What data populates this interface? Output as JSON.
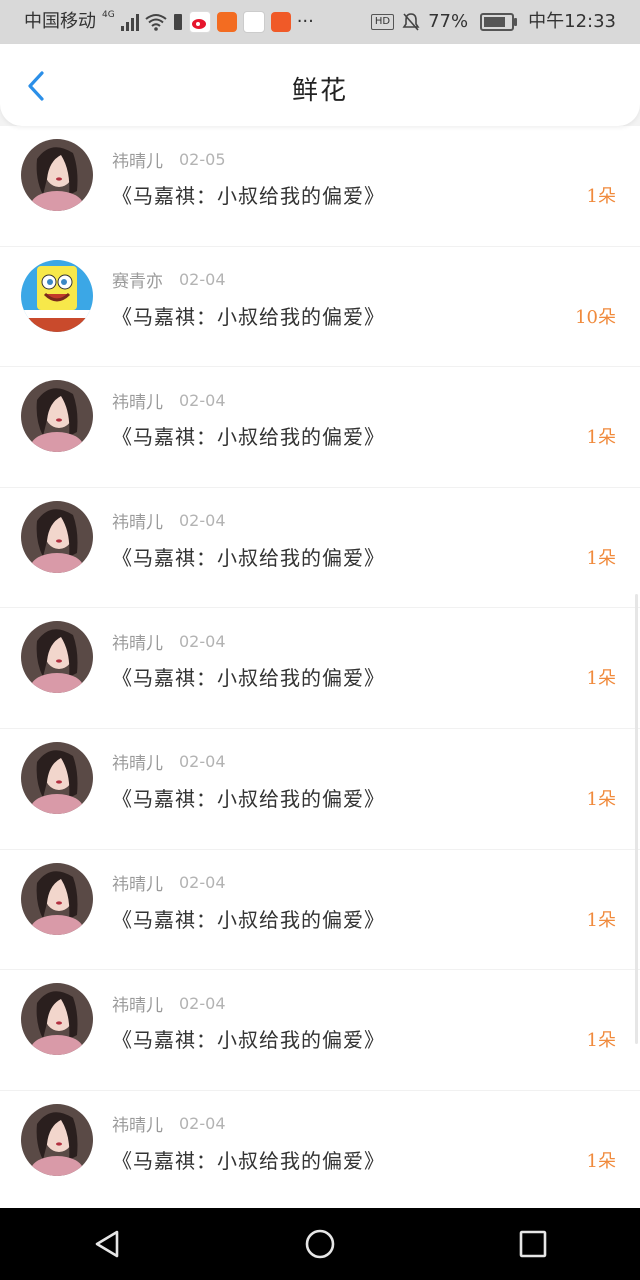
{
  "status_bar": {
    "carrier": "中国移动",
    "network_label": "4G",
    "battery_percent": "77%",
    "hd_label": "HD",
    "time": "中午12:33",
    "more_label": "···"
  },
  "header": {
    "title": "鲜花"
  },
  "accent_colors": {
    "back_arrow": "#2b8fe8",
    "count": "#f08a3c"
  },
  "list": [
    {
      "username": "祎晴儿",
      "date": "02-05",
      "book_title": "《马嘉祺：小叔给我的偏爱》",
      "count": "1朵",
      "avatar": "girl"
    },
    {
      "username": "赛青亦",
      "date": "02-04",
      "book_title": "《马嘉祺：小叔给我的偏爱》",
      "count": "10朵",
      "avatar": "sponge"
    },
    {
      "username": "祎晴儿",
      "date": "02-04",
      "book_title": "《马嘉祺：小叔给我的偏爱》",
      "count": "1朵",
      "avatar": "girl"
    },
    {
      "username": "祎晴儿",
      "date": "02-04",
      "book_title": "《马嘉祺：小叔给我的偏爱》",
      "count": "1朵",
      "avatar": "girl"
    },
    {
      "username": "祎晴儿",
      "date": "02-04",
      "book_title": "《马嘉祺：小叔给我的偏爱》",
      "count": "1朵",
      "avatar": "girl"
    },
    {
      "username": "祎晴儿",
      "date": "02-04",
      "book_title": "《马嘉祺：小叔给我的偏爱》",
      "count": "1朵",
      "avatar": "girl"
    },
    {
      "username": "祎晴儿",
      "date": "02-04",
      "book_title": "《马嘉祺：小叔给我的偏爱》",
      "count": "1朵",
      "avatar": "girl"
    },
    {
      "username": "祎晴儿",
      "date": "02-04",
      "book_title": "《马嘉祺：小叔给我的偏爱》",
      "count": "1朵",
      "avatar": "girl"
    },
    {
      "username": "祎晴儿",
      "date": "02-04",
      "book_title": "《马嘉祺：小叔给我的偏爱》",
      "count": "1朵",
      "avatar": "girl"
    }
  ],
  "nav": {
    "back_icon": "triangle-back-icon",
    "home_icon": "circle-home-icon",
    "recents_icon": "square-recents-icon"
  }
}
